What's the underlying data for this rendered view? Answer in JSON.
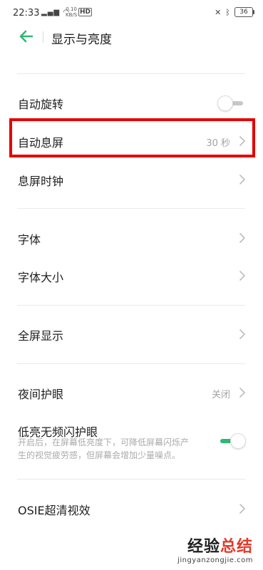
{
  "status_bar": {
    "time": "22:33",
    "network": "4G ull",
    "speed_value": "0.10",
    "speed_unit": "KB/S",
    "hd": "HD",
    "battery": "36"
  },
  "header": {
    "title": "显示与亮度"
  },
  "items": {
    "auto_rotate": {
      "label": "自动旋转",
      "toggle_on": false
    },
    "screen_timeout": {
      "label": "自动息屏",
      "value": "30 秒"
    },
    "screen_off_clock": {
      "label": "息屏时钟"
    },
    "font": {
      "label": "字体"
    },
    "font_size": {
      "label": "字体大小"
    },
    "fullscreen": {
      "label": "全屏显示"
    },
    "night_shield": {
      "label": "夜间护眼",
      "value": "关闭"
    },
    "dc_dimming": {
      "label": "低亮无频闪护眼",
      "description_line1": "开启后，在屏幕低亮度下，可降低屏幕闪烁产",
      "description_line2": "生的视觉疲劳感，但屏幕会增加少量噪点。",
      "toggle_on": true
    },
    "osie": {
      "label": "OSIE超清视效"
    }
  },
  "watermark": {
    "part1": "经验",
    "part2": "总结",
    "url": "jingyanzongjie.com"
  },
  "colors": {
    "accent": "#2fb872",
    "highlight": "#e60000",
    "toggle_off_track": "#c8c8c8"
  }
}
